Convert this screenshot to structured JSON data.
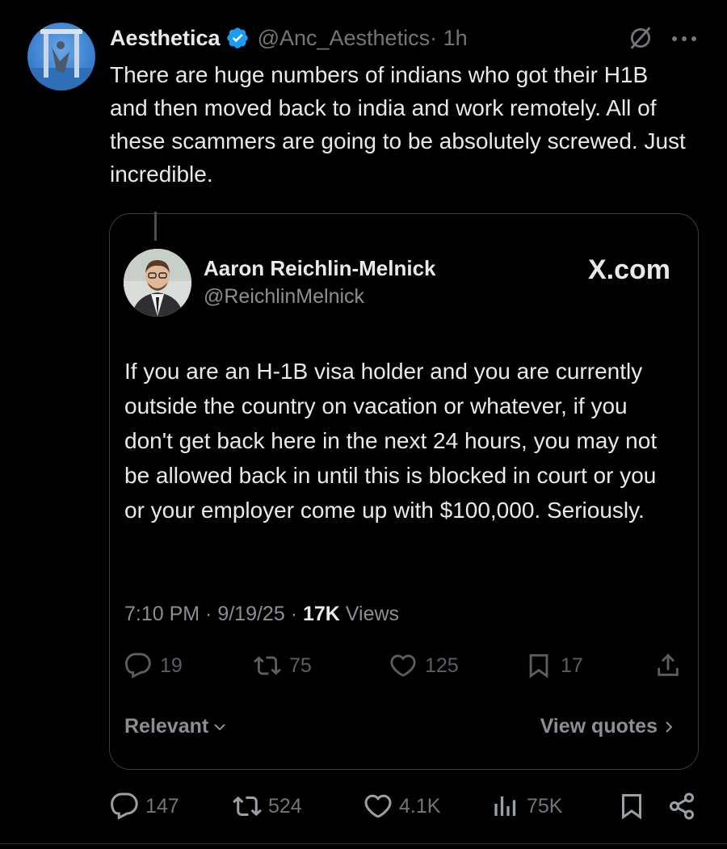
{
  "post": {
    "author_name": "Aesthetica",
    "author_handle": "@Anc_Aesthetics",
    "time": " · 1h",
    "text": "There are huge numbers of indians who got their H1B and then moved back to india and work remotely. All of these scammers are going to be absolutely screwed. Just incredible.",
    "verified_color": "#1d9bf0"
  },
  "quote": {
    "author_name": "Aaron Reichlin-Melnick",
    "author_handle": "@ReichlinMelnick",
    "source": "X.com",
    "text": "If you are an H-1B visa holder and you are currently outside the country on vacation or whatever, if you don't get back here in the next 24 hours, you may not be allowed back in until this is blocked in court or you or your employer come up with $100,000. Seriously.",
    "time": "7:10 PM",
    "date": "9/19/25",
    "views_count": "17K",
    "views_label": "Views",
    "replies": "19",
    "reposts": "75",
    "likes": "125",
    "bookmarks": "17",
    "relevant_label": "Relevant",
    "view_quotes_label": "View quotes"
  },
  "actions": {
    "replies": "147",
    "reposts": "524",
    "likes": "4.1K",
    "views": "75K"
  },
  "icons": [
    "grok-icon",
    "more-icon",
    "verified-icon",
    "reply-icon",
    "repost-icon",
    "like-icon",
    "bookmark-icon",
    "share-icon",
    "views-icon",
    "chevron-down-icon",
    "chevron-right-icon"
  ]
}
